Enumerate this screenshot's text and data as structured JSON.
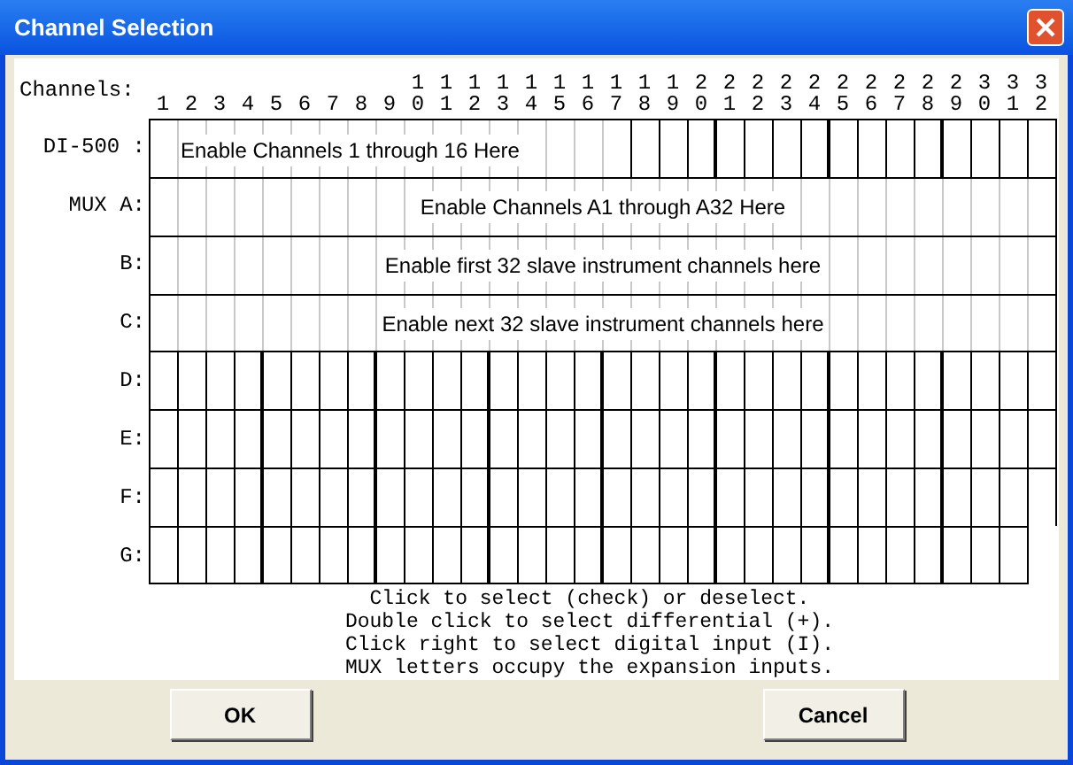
{
  "window": {
    "title": "Channel Selection"
  },
  "channels_label": "Channels:",
  "channel_numbers": [
    "1",
    "2",
    "3",
    "4",
    "5",
    "6",
    "7",
    "8",
    "9",
    "10",
    "11",
    "12",
    "13",
    "14",
    "15",
    "16",
    "17",
    "18",
    "19",
    "20",
    "21",
    "22",
    "23",
    "24",
    "25",
    "26",
    "27",
    "28",
    "29",
    "30",
    "31",
    "32"
  ],
  "rows": [
    {
      "label": "DI-500 :",
      "kind": "half_banner",
      "banner": "Enable Channels 1 through 16 Here"
    },
    {
      "label": "MUX A:",
      "kind": "banner",
      "banner": "Enable Channels A1 through A32 Here"
    },
    {
      "label": "B:",
      "kind": "banner",
      "banner": "Enable first 32 slave instrument channels here"
    },
    {
      "label": "C:",
      "kind": "banner",
      "banner": "Enable next 32 slave instrument channels here"
    },
    {
      "label": "D:",
      "kind": "cells"
    },
    {
      "label": "E:",
      "kind": "cells"
    },
    {
      "label": "F:",
      "kind": "cells"
    },
    {
      "label": "G:",
      "kind": "cells_short"
    }
  ],
  "instructions": [
    "Click to select (check) or deselect.",
    "Double click to select differential (+).",
    "Click right to select digital input (I).",
    "MUX letters occupy the expansion inputs."
  ],
  "buttons": [
    "OK",
    "Cancel"
  ]
}
